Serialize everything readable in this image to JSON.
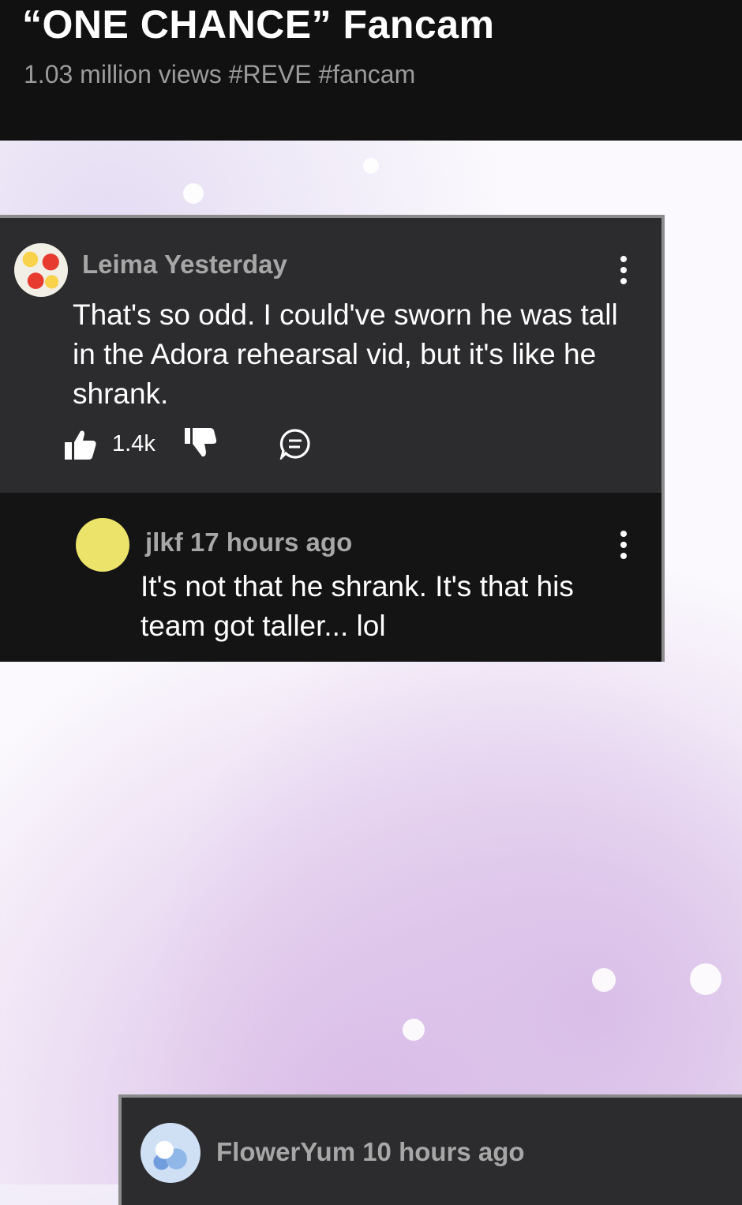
{
  "header": {
    "title": "“ONE CHANCE” Fancam",
    "subtitle": "1.03 million views #REVE #fancam"
  },
  "comments": [
    {
      "author_time": "Leima Yesterday",
      "text": "That's so odd. I could've sworn he was tall in the Adora rehearsal vid, but it's like he shrank.",
      "likes": "1.4k",
      "reply": {
        "author_time": "jlkf 17 hours ago",
        "text": "It's not that he shrank. It's that his team got taller... lol"
      }
    },
    {
      "author_time": "FlowerYum 10 hours ago"
    }
  ],
  "colors": {
    "header_bg": "#111111",
    "card_bg": "#2c2c2e",
    "reply_bg": "#141414",
    "meta_text": "#a7a7a7",
    "avatar_jlkf": "#ece46a"
  },
  "icons": [
    "more-vert-icon",
    "thumbs-up-icon",
    "thumbs-down-icon",
    "reply-bubble-icon"
  ]
}
